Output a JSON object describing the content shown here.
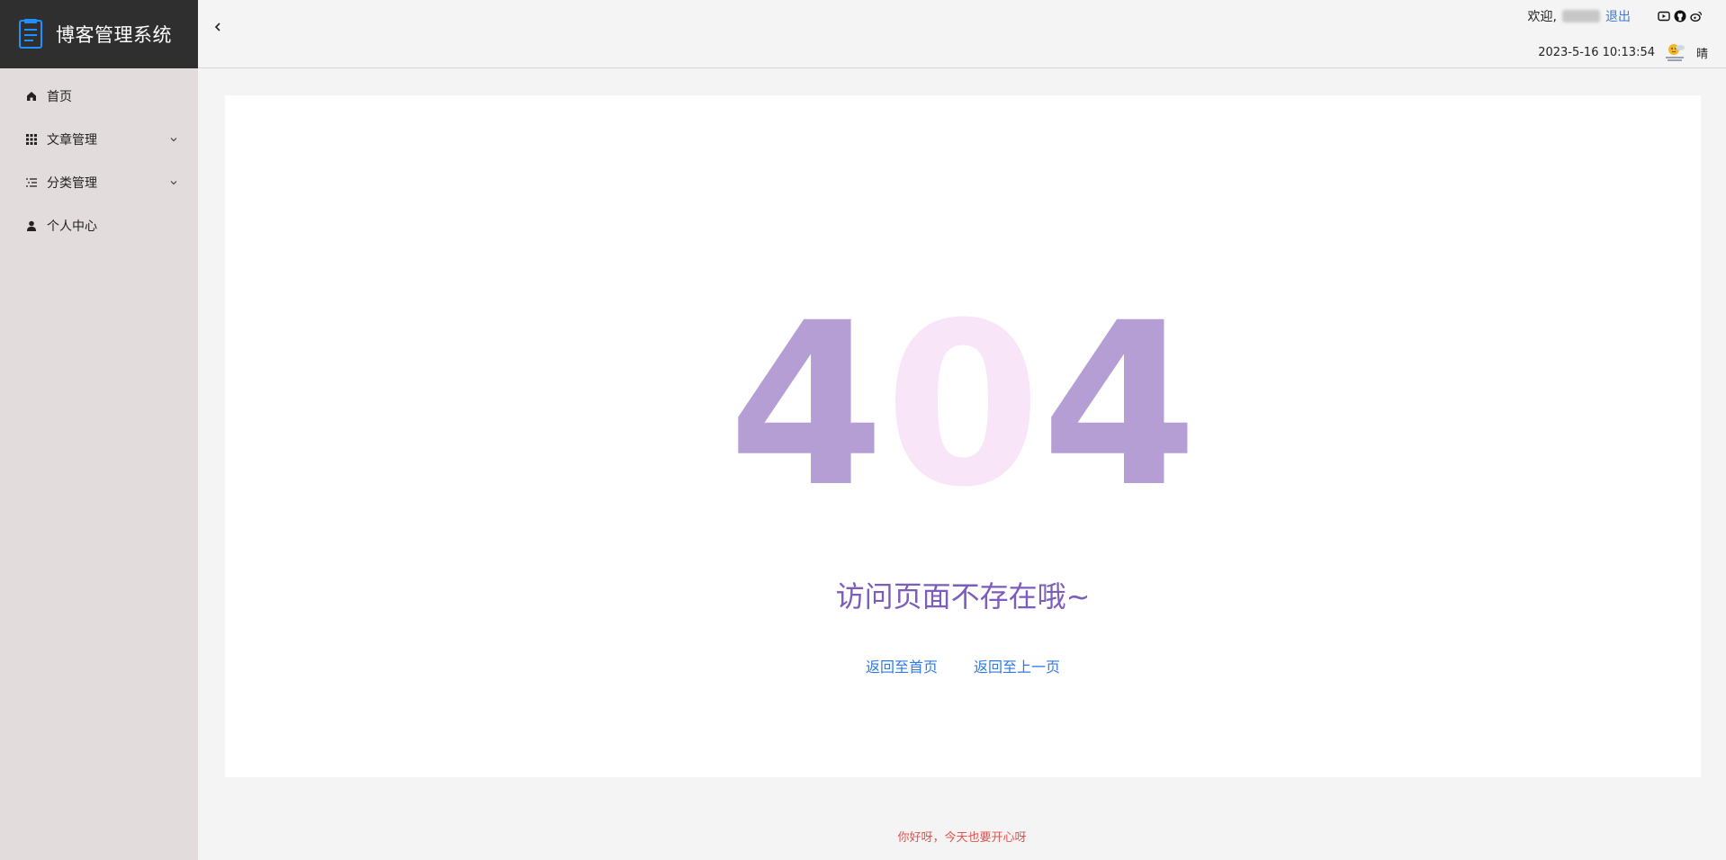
{
  "app": {
    "title": "博客管理系统"
  },
  "sidebar": {
    "items": [
      {
        "label": "首页",
        "icon": "home-icon",
        "has_submenu": false
      },
      {
        "label": "文章管理",
        "icon": "grid-icon",
        "has_submenu": true
      },
      {
        "label": "分类管理",
        "icon": "list-icon",
        "has_submenu": true
      },
      {
        "label": "个人中心",
        "icon": "user-icon",
        "has_submenu": false
      }
    ]
  },
  "header": {
    "welcome": "欢迎,",
    "logout": "退出",
    "social_icons": [
      "video-icon",
      "github-icon",
      "weibo-icon"
    ],
    "datetime": "2023-5-16 10:13:54",
    "weather": {
      "icon": "weather-icon",
      "text": "晴"
    }
  },
  "main": {
    "error_code": {
      "d1": "4",
      "d2": "0",
      "d3": "4"
    },
    "message": "访问页面不存在哦~",
    "links": {
      "home": "返回至首页",
      "back": "返回至上一页"
    }
  },
  "footer": {
    "text": "你好呀，今天也要开心呀"
  },
  "colors": {
    "brand_bg": "#2f2f2f",
    "sidebar_bg": "#e2dcdc",
    "digit_primary": "#b59ed3",
    "digit_secondary": "#f8e6f8",
    "message": "#7c5cbd",
    "link": "#2f7ae5",
    "footer": "#e2534f"
  }
}
